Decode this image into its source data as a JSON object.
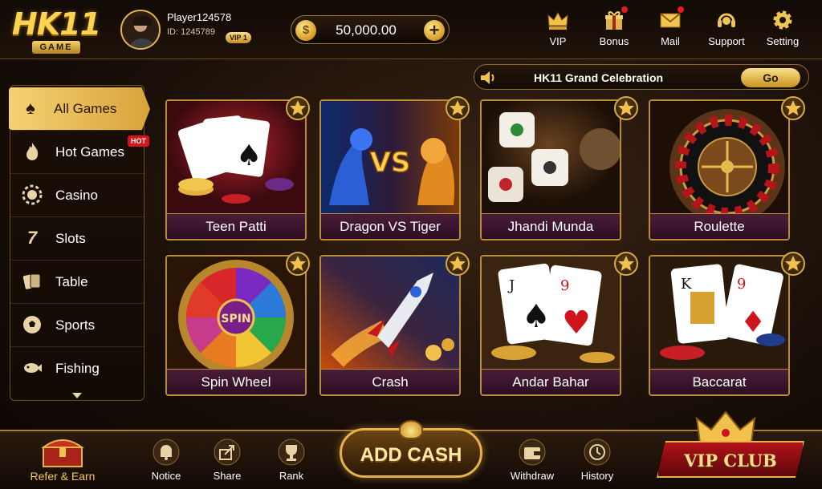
{
  "header": {
    "logo_main": "HK11",
    "logo_sub": "GAME",
    "player_name": "Player124578",
    "player_id": "ID: 1245789",
    "vip_level": "VIP 1",
    "balance": "50,000.00",
    "coin_symbol": "$",
    "nav": [
      {
        "label": "VIP",
        "icon": "crown-icon",
        "badge": false
      },
      {
        "label": "Bonus",
        "icon": "gift-icon",
        "badge": true
      },
      {
        "label": "Mail",
        "icon": "mail-icon",
        "badge": true
      },
      {
        "label": "Support",
        "icon": "headset-icon",
        "badge": false
      },
      {
        "label": "Setting",
        "icon": "gear-icon",
        "badge": false
      }
    ]
  },
  "announcement": {
    "text": "HK11 Grand Celebration",
    "button_label": "Go",
    "icon": "speaker-icon"
  },
  "sidebar": {
    "items": [
      {
        "label": "All Games",
        "icon": "spade-icon",
        "active": true
      },
      {
        "label": "Hot Games",
        "icon": "flame-icon",
        "tag": "HOT"
      },
      {
        "label": "Casino",
        "icon": "chip-icon"
      },
      {
        "label": "Slots",
        "icon": "seven-icon"
      },
      {
        "label": "Table",
        "icon": "cards-icon"
      },
      {
        "label": "Sports",
        "icon": "soccer-ball-icon"
      },
      {
        "label": "Fishing",
        "icon": "fish-icon"
      }
    ],
    "more_icon": "chevron-down-icon"
  },
  "games": [
    {
      "name": "Teen Patti",
      "favorite": true
    },
    {
      "name": "Dragon VS Tiger",
      "favorite": true,
      "vs_text": "VS"
    },
    {
      "name": "Jhandi Munda",
      "favorite": true
    },
    {
      "name": "Roulette",
      "favorite": true
    },
    {
      "name": "Spin Wheel",
      "favorite": true,
      "center_text": "SPIN"
    },
    {
      "name": "Crash",
      "favorite": true
    },
    {
      "name": "Andar Bahar",
      "favorite": true
    },
    {
      "name": "Baccarat",
      "favorite": true
    }
  ],
  "bottom_nav": {
    "refer": {
      "label": "Refer & Earn",
      "icon": "treasure-chest-icon"
    },
    "items": [
      {
        "label": "Notice",
        "icon": "bell-icon"
      },
      {
        "label": "Share",
        "icon": "share-icon"
      },
      {
        "label": "Rank",
        "icon": "trophy-icon"
      },
      {
        "label": "Withdraw",
        "icon": "wallet-icon"
      },
      {
        "label": "History",
        "icon": "clock-icon"
      }
    ],
    "add_cash": "ADD CASH",
    "vip_club": "VIP CLUB"
  },
  "colors": {
    "gold": "#f3c94f",
    "caption_bg": "#4a1d3a",
    "hot_red": "#d8141c"
  }
}
